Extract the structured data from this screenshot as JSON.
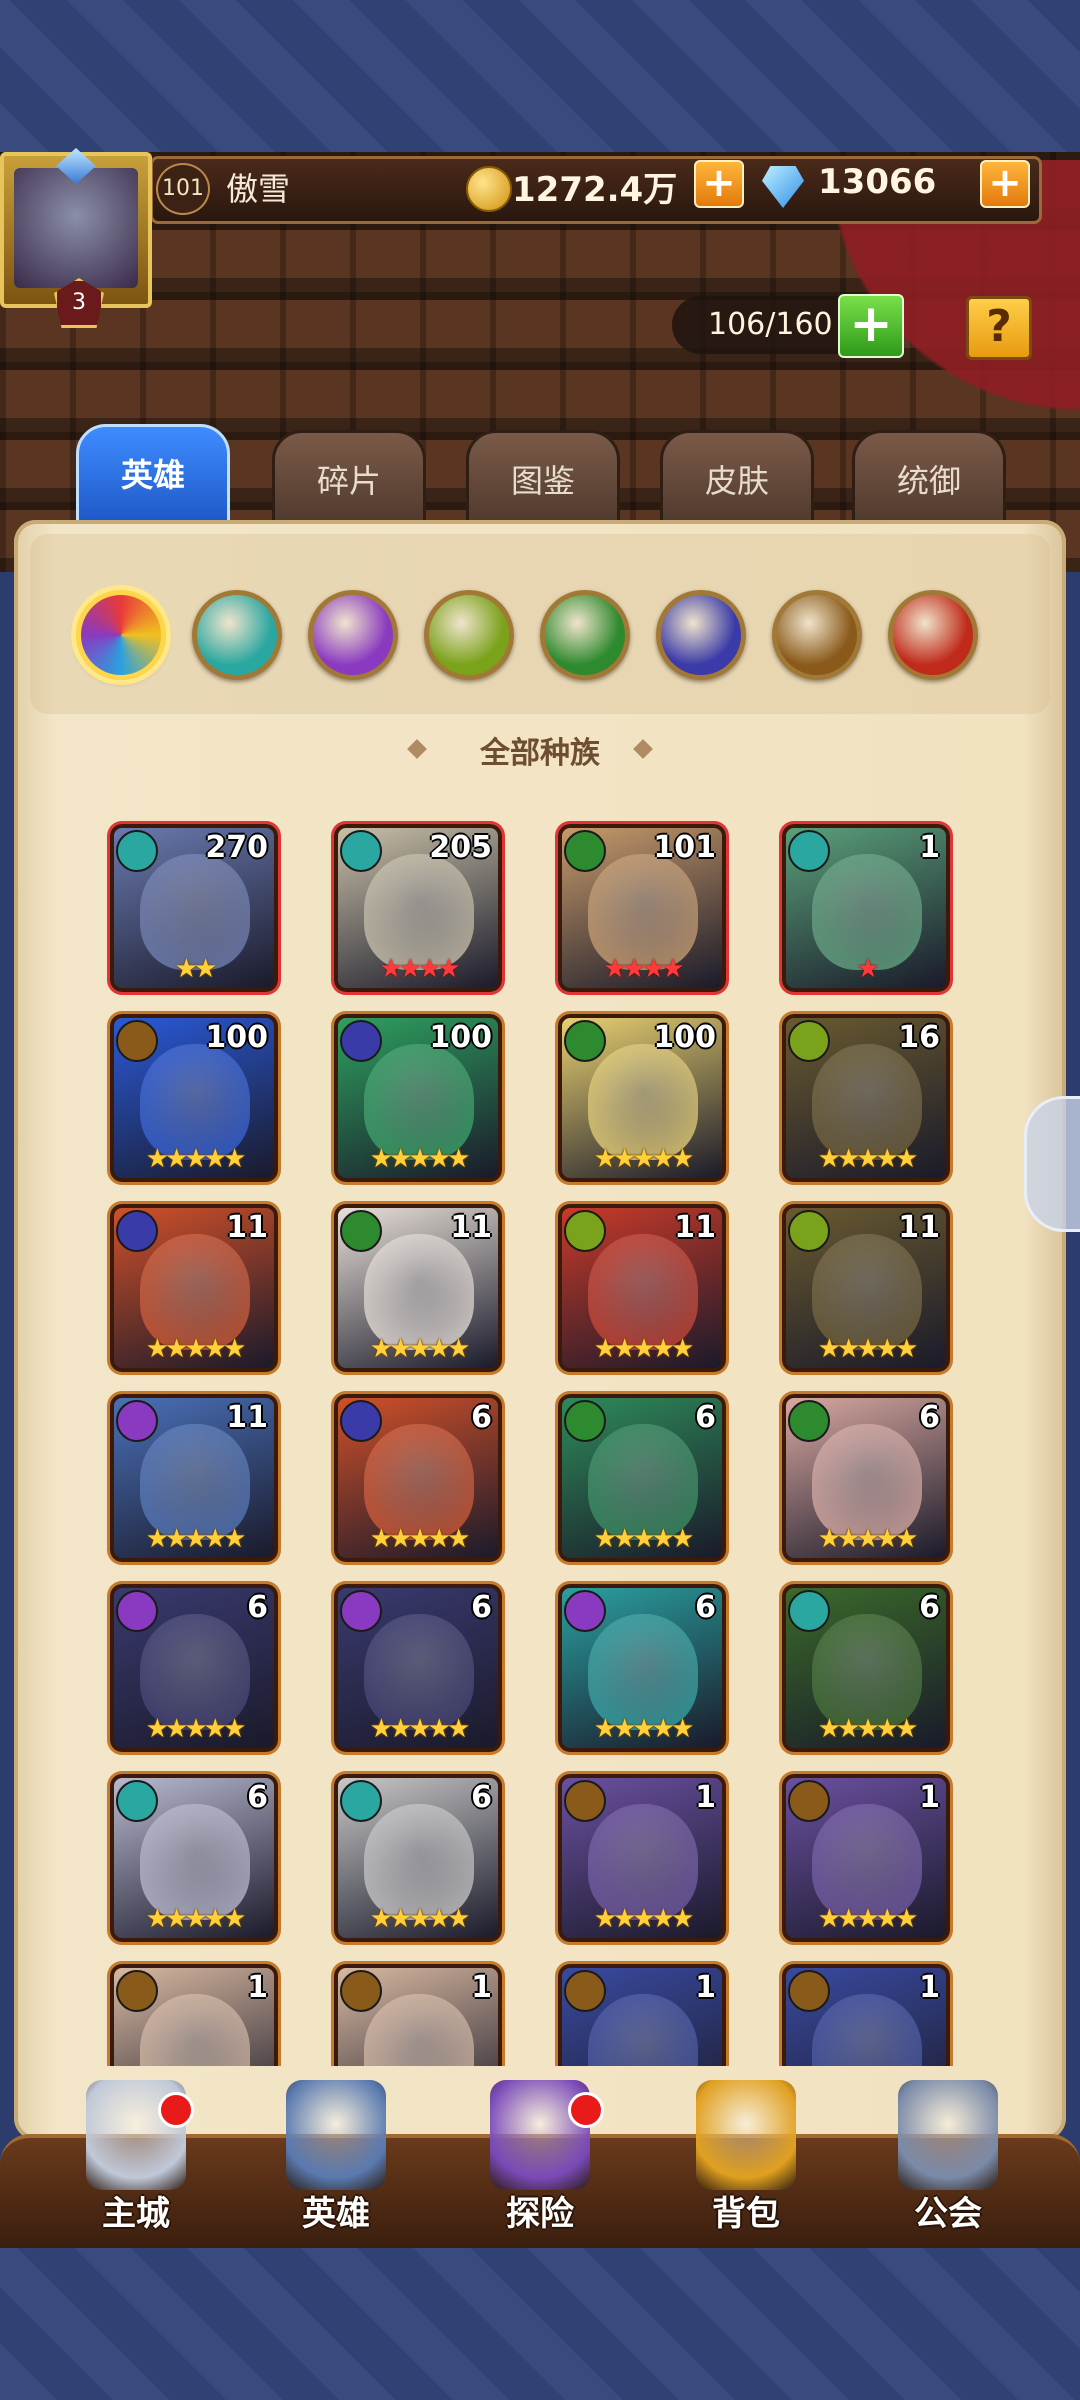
{
  "player": {
    "level": "101",
    "name": "傲雪",
    "rank_badge": "3",
    "gold": "1272.4万",
    "gems": "13066"
  },
  "hero_capacity": "106/160",
  "help_label": "?",
  "plus_symbol": "+",
  "tabs": [
    {
      "label": "英雄",
      "active": true
    },
    {
      "label": "碎片",
      "active": false
    },
    {
      "label": "图鉴",
      "active": false
    },
    {
      "label": "皮肤",
      "active": false
    },
    {
      "label": "统御",
      "active": false
    }
  ],
  "faction_filters": [
    {
      "icon": "all-races-icon",
      "color": "#e85a3a",
      "active": true
    },
    {
      "icon": "faction-ice-icon",
      "color": "#2aa7a0"
    },
    {
      "icon": "faction-shadow-icon",
      "color": "#8a3ac0"
    },
    {
      "icon": "faction-earth-icon",
      "color": "#7aa21a"
    },
    {
      "icon": "faction-forest-icon",
      "color": "#2e8a2e"
    },
    {
      "icon": "faction-abyss-icon",
      "color": "#3a3aa8"
    },
    {
      "icon": "faction-light-icon",
      "color": "#8a5a1a"
    },
    {
      "icon": "faction-fire-icon",
      "color": "#c02a1a"
    }
  ],
  "section_title": "全部种族",
  "heroes": [
    {
      "count": "270",
      "faction": "faction-ice-icon",
      "faction_color": "#2aa7a0",
      "stars": "★★",
      "star_color": "gold",
      "frame": "red",
      "tone": "#6a7ab0"
    },
    {
      "count": "205",
      "faction": "faction-ice-icon",
      "faction_color": "#2aa7a0",
      "stars": "★★★★",
      "star_color": "red",
      "frame": "red",
      "tone": "#c9c0a8"
    },
    {
      "count": "101",
      "faction": "faction-forest-icon",
      "faction_color": "#2e8a2e",
      "stars": "★★★★",
      "star_color": "red",
      "frame": "red",
      "tone": "#c79a6a"
    },
    {
      "count": "1",
      "faction": "faction-ice-icon",
      "faction_color": "#2aa7a0",
      "stars": "★",
      "star_color": "red",
      "frame": "red",
      "tone": "#5aa07a"
    },
    {
      "count": "100",
      "faction": "faction-light-icon",
      "faction_color": "#8a5a1a",
      "stars": "★★★★★",
      "star_color": "gold",
      "frame": "orange",
      "tone": "#2a5ad8"
    },
    {
      "count": "100",
      "faction": "faction-abyss-icon",
      "faction_color": "#3a3aa8",
      "stars": "★★★★★",
      "star_color": "gold",
      "frame": "orange",
      "tone": "#2ea060"
    },
    {
      "count": "100",
      "faction": "faction-forest-icon",
      "faction_color": "#2e8a2e",
      "stars": "★★★★★",
      "star_color": "gold",
      "frame": "orange",
      "tone": "#e8d070"
    },
    {
      "count": "16",
      "faction": "faction-earth-icon",
      "faction_color": "#7aa21a",
      "stars": "★★★★★",
      "star_color": "gold",
      "frame": "orange",
      "tone": "#6a5a30"
    },
    {
      "count": "11",
      "faction": "faction-abyss-icon",
      "faction_color": "#3a3aa8",
      "stars": "★★★★★",
      "star_color": "gold",
      "frame": "orange",
      "tone": "#d0502a"
    },
    {
      "count": "11",
      "faction": "faction-forest-icon",
      "faction_color": "#2e8a2e",
      "stars": "★★★★★",
      "star_color": "gold",
      "frame": "orange",
      "tone": "#e8e0d8"
    },
    {
      "count": "11",
      "faction": "faction-earth-icon",
      "faction_color": "#7aa21a",
      "stars": "★★★★★",
      "star_color": "gold",
      "frame": "orange",
      "tone": "#c83a2a"
    },
    {
      "count": "11",
      "faction": "faction-earth-icon",
      "faction_color": "#7aa21a",
      "stars": "★★★★★",
      "star_color": "gold",
      "frame": "orange",
      "tone": "#6a5a30"
    },
    {
      "count": "11",
      "faction": "faction-shadow-icon",
      "faction_color": "#8a3ac0",
      "stars": "★★★★★",
      "star_color": "gold",
      "frame": "orange",
      "tone": "#4a70b8"
    },
    {
      "count": "6",
      "faction": "faction-abyss-icon",
      "faction_color": "#3a3aa8",
      "stars": "★★★★★",
      "star_color": "gold",
      "frame": "orange",
      "tone": "#d0502a"
    },
    {
      "count": "6",
      "faction": "faction-forest-icon",
      "faction_color": "#2e8a2e",
      "stars": "★★★★★",
      "star_color": "gold",
      "frame": "orange",
      "tone": "#2e8a5a"
    },
    {
      "count": "6",
      "faction": "faction-forest-icon",
      "faction_color": "#2e8a2e",
      "stars": "★★★★★",
      "star_color": "gold",
      "frame": "orange",
      "tone": "#d8a8a0"
    },
    {
      "count": "6",
      "faction": "faction-shadow-icon",
      "faction_color": "#8a3ac0",
      "stars": "★★★★★",
      "star_color": "gold",
      "frame": "orange",
      "tone": "#3a3a70"
    },
    {
      "count": "6",
      "faction": "faction-shadow-icon",
      "faction_color": "#8a3ac0",
      "stars": "★★★★★",
      "star_color": "gold",
      "frame": "orange",
      "tone": "#3a3a70"
    },
    {
      "count": "6",
      "faction": "faction-shadow-icon",
      "faction_color": "#8a3ac0",
      "stars": "★★★★★",
      "star_color": "gold",
      "frame": "orange",
      "tone": "#2aa0a0"
    },
    {
      "count": "6",
      "faction": "faction-ice-icon",
      "faction_color": "#2aa7a0",
      "stars": "★★★★★",
      "star_color": "gold",
      "frame": "orange",
      "tone": "#3a6a2a"
    },
    {
      "count": "6",
      "faction": "faction-ice-icon",
      "faction_color": "#2aa7a0",
      "stars": "★★★★★",
      "star_color": "gold",
      "frame": "orange",
      "tone": "#b8b8d0"
    },
    {
      "count": "6",
      "faction": "faction-ice-icon",
      "faction_color": "#2aa7a0",
      "stars": "★★★★★",
      "star_color": "gold",
      "frame": "orange",
      "tone": "#c8c8c8"
    },
    {
      "count": "1",
      "faction": "faction-light-icon",
      "faction_color": "#8a5a1a",
      "stars": "★★★★★",
      "star_color": "gold",
      "frame": "orange",
      "tone": "#6a50a0"
    },
    {
      "count": "1",
      "faction": "faction-light-icon",
      "faction_color": "#8a5a1a",
      "stars": "★★★★★",
      "star_color": "gold",
      "frame": "orange",
      "tone": "#6a50a0"
    },
    {
      "count": "1",
      "faction": "faction-light-icon",
      "faction_color": "#8a5a1a",
      "stars": "",
      "star_color": "gold",
      "frame": "orange",
      "tone": "#d8b8a0"
    },
    {
      "count": "1",
      "faction": "faction-light-icon",
      "faction_color": "#8a5a1a",
      "stars": "",
      "star_color": "gold",
      "frame": "orange",
      "tone": "#d8b8a0"
    },
    {
      "count": "1",
      "faction": "faction-light-icon",
      "faction_color": "#8a5a1a",
      "stars": "",
      "star_color": "gold",
      "frame": "orange",
      "tone": "#3a4aa0"
    },
    {
      "count": "1",
      "faction": "faction-light-icon",
      "faction_color": "#8a5a1a",
      "stars": "",
      "star_color": "gold",
      "frame": "orange",
      "tone": "#3a4aa0"
    }
  ],
  "bottom_nav": [
    {
      "label": "主城",
      "icon": "castle-icon",
      "badge": true
    },
    {
      "label": "英雄",
      "icon": "hero-icon",
      "badge": false
    },
    {
      "label": "探险",
      "icon": "portal-icon",
      "badge": true
    },
    {
      "label": "背包",
      "icon": "backpack-icon",
      "badge": false
    },
    {
      "label": "公会",
      "icon": "guild-icon",
      "badge": false
    }
  ]
}
